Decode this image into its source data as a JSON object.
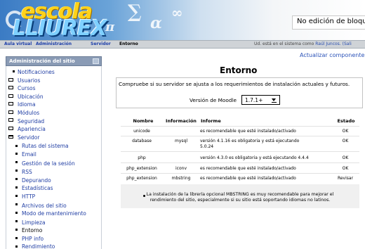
{
  "header": {
    "logo_top": "escola",
    "logo_bottom": "LLIUREX",
    "title": "No edición de bloques"
  },
  "navbar": {
    "crumbs": [
      "Aula virtual",
      "Administración",
      "Servidor",
      "Entorno"
    ],
    "login_text": "Ud. está en el sistema como ",
    "login_user": "Raúl Juncos. (Sali"
  },
  "sidebar": {
    "title": "Administración del sitio",
    "items": [
      {
        "label": "Notificaciones"
      },
      {
        "label": "Usuarios"
      },
      {
        "label": "Cursos"
      },
      {
        "label": "Ubicación"
      },
      {
        "label": "Idioma"
      },
      {
        "label": "Módulos"
      },
      {
        "label": "Seguridad"
      },
      {
        "label": "Apariencia"
      },
      {
        "label": "Servidor"
      },
      {
        "label": "Rutas del sistema"
      },
      {
        "label": "Email"
      },
      {
        "label": "Gestión de la sesión"
      },
      {
        "label": "RSS"
      },
      {
        "label": "Depurando"
      },
      {
        "label": "Estadísticas"
      },
      {
        "label": "HTTP"
      },
      {
        "label": "Archivos del sitio"
      },
      {
        "label": "Modo de mantenimiento"
      },
      {
        "label": "Limpieza"
      },
      {
        "label": "Entorno"
      },
      {
        "label": "PHP info"
      },
      {
        "label": "Rendimiento"
      }
    ]
  },
  "main": {
    "update_link": "Actualizar componente",
    "page_title": "Entorno",
    "info_text": "Compruebe si su servidor se ajusta a los requerimientos de instalación actuales y futuros.",
    "version_label": "Versión de Moodle",
    "version_value": "1.7.1+",
    "table": {
      "headers": [
        "Nombre",
        "Información",
        "Informe",
        "Estado"
      ],
      "rows": [
        {
          "name": "unicode",
          "info": "",
          "report": "es recomendable que esté instalado/activado",
          "report2": "",
          "status": "OK"
        },
        {
          "name": "database",
          "info": "mysql",
          "report": "versión 4.1.16 es obligatoria y está ejecutando",
          "report2": "5.0.24",
          "status": "OK"
        },
        {
          "name": "php",
          "info": "",
          "report": "versión 4.3.0 es obligatoria y está ejecutando 4.4.4",
          "report2": "",
          "status": "OK"
        },
        {
          "name": "php_extension",
          "info": "iconv",
          "report": "es recomendable que esté instalado/activado",
          "report2": "",
          "status": "OK"
        },
        {
          "name": "php_extension",
          "info": "mbstring",
          "report": "es recomendable que esté instalado/activado",
          "report2": "",
          "status": "Revisar"
        }
      ],
      "note_line1": "La instalación de la librería opcional MBSTRING es muy recomendable para mejorar el",
      "note_line2": "rendimiento del sitio, especialmente si su sitio está soportando idiomas no latinos."
    }
  }
}
